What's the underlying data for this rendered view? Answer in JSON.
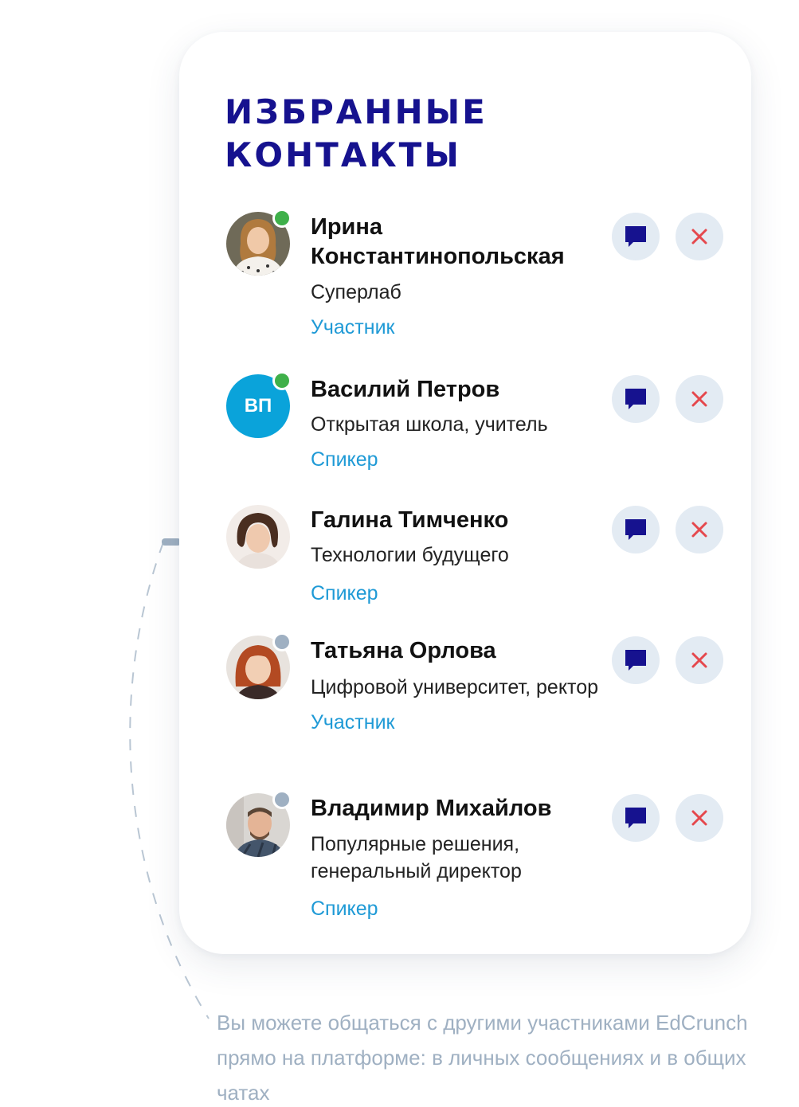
{
  "card": {
    "title_line1": "Избранные",
    "title_line2": "контакты"
  },
  "contacts": [
    {
      "name": "Ирина Константинопольская",
      "org": "Суперлаб",
      "role": "Участник",
      "status": "online",
      "avatar": "photo"
    },
    {
      "name": "Василий Петров",
      "org": "Открытая школа, учитель",
      "role": "Спикер",
      "status": "online",
      "avatar": "initials",
      "initials": "ВП"
    },
    {
      "name": "Галина Тимченко",
      "org": "Технологии будущего",
      "role": "Спикер",
      "status": "none",
      "avatar": "photo"
    },
    {
      "name": "Татьяна Орлова",
      "org": "Цифровой университет, ректор",
      "role": "Участник",
      "status": "offline",
      "avatar": "photo"
    },
    {
      "name": "Владимир Михайлов",
      "org": "Популярные решения, генеральный директор",
      "role": "Спикер",
      "status": "offline",
      "avatar": "photo"
    }
  ],
  "actions": {
    "chat_icon": "chat-bubble-icon",
    "remove_icon": "close-icon"
  },
  "caption": "Вы можете общаться с другими участниками EdCrunch прямо на платформе: в личных сообщениях и в общих чатах",
  "colors": {
    "title": "#16128f",
    "role": "#1f9ad6",
    "online": "#3fb04a",
    "offline": "#9fb0c2",
    "chat_icon": "#16128f",
    "remove_icon": "#e5484d",
    "button_bg": "#e3ebf3",
    "initials_bg": "#0aa3da",
    "caption": "#9fb0c2"
  }
}
